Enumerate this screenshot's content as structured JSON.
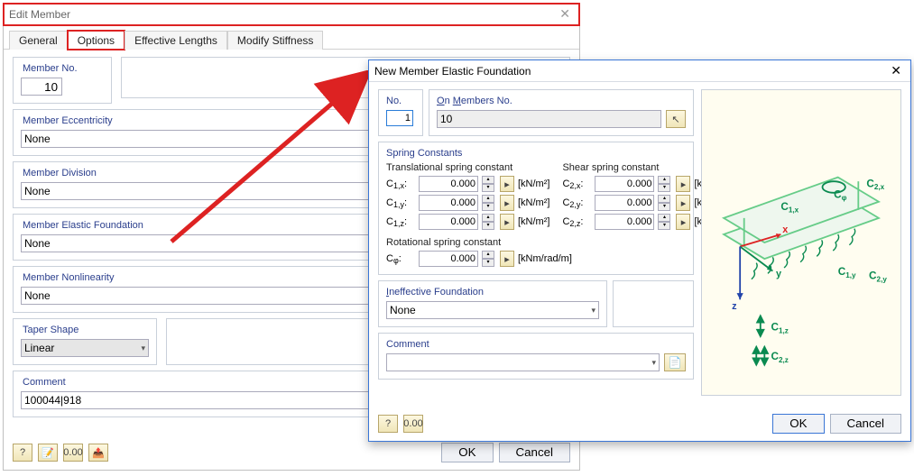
{
  "back": {
    "title": "Edit Member",
    "tabs": [
      "General",
      "Options",
      "Effective Lengths",
      "Modify Stiffness"
    ],
    "member_no_legend": "Member No.",
    "member_no_value": "10",
    "sections": {
      "ecc": {
        "legend": "Member Eccentricity",
        "value": "None"
      },
      "div": {
        "legend": "Member Division",
        "value": "None"
      },
      "ef": {
        "legend": "Member Elastic Foundation",
        "value": "None"
      },
      "nl": {
        "legend": "Member Nonlinearity",
        "value": "None"
      },
      "taper": {
        "legend": "Taper Shape",
        "value": "Linear"
      },
      "comment": {
        "legend": "Comment",
        "value": "100044|918"
      }
    },
    "buttons": {
      "help": "?",
      "ok": "OK",
      "cancel": "Cancel"
    }
  },
  "front": {
    "title": "New Member Elastic Foundation",
    "no_legend": "No.",
    "no_value": "1",
    "on_members_legend": "On Members No.",
    "on_members_value": "10",
    "spring_legend": "Spring Constants",
    "trans_head": "Translational spring constant",
    "shear_head": "Shear spring constant",
    "c1x": {
      "label": "C1,x:",
      "value": "0.000",
      "unit": "[kN/m²]"
    },
    "c1y": {
      "label": "C1,y:",
      "value": "0.000",
      "unit": "[kN/m²]"
    },
    "c1z": {
      "label": "C1,z:",
      "value": "0.000",
      "unit": "[kN/m²]"
    },
    "c2x": {
      "label": "C2,x:",
      "value": "0.000",
      "unit": "[kN]"
    },
    "c2y": {
      "label": "C2,y:",
      "value": "0.000",
      "unit": "[kN]"
    },
    "c2z": {
      "label": "C2,z:",
      "value": "0.000",
      "unit": "[kN]"
    },
    "rot_head": "Rotational spring constant",
    "cphi": {
      "label": "Cφ:",
      "value": "0.000",
      "unit": "[kNm/rad/m]"
    },
    "ineffective": {
      "legend": "Ineffective Foundation",
      "value": "None"
    },
    "comment": {
      "legend": "Comment",
      "value": ""
    },
    "buttons": {
      "ok": "OK",
      "cancel": "Cancel"
    },
    "axis_labels": {
      "c1x": "C1,x",
      "c2x": "C2,x",
      "cphi": "Cφ",
      "c1y": "C1,y",
      "c2y": "C2,y",
      "c1z": "C1,z",
      "c2z": "C2,z",
      "x": "x",
      "y": "y",
      "z": "z"
    }
  }
}
